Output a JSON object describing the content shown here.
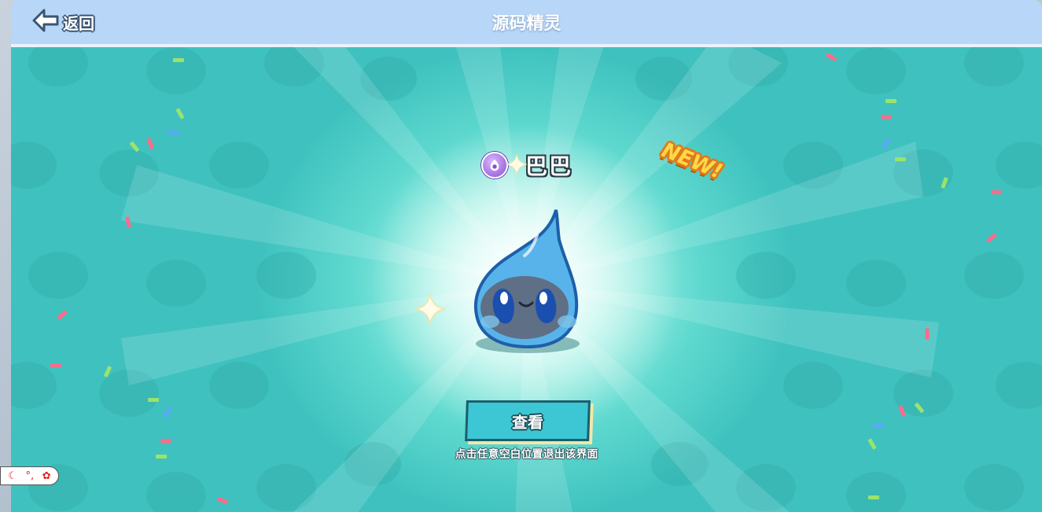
{
  "header": {
    "back_label": "返回",
    "title": "源码精灵"
  },
  "reveal": {
    "pet_name": "巴巴",
    "new_badge": "NEW!",
    "view_button_label": "查看",
    "hint": "点击任意空白位置退出该界面"
  },
  "icons": {
    "back": "arrow-left-icon",
    "rarity": "rarity-badge-icon",
    "sparkle": "sparkle-icon",
    "creature": "water-drop-creature",
    "float_tools": [
      "moon-icon",
      "dots-icon",
      "gear-icon"
    ]
  },
  "float_tool_glyphs": [
    "☾",
    "°,",
    "✿"
  ],
  "colors": {
    "topbar": "#b8d6f7",
    "stage": "#3fc2bf",
    "button": "#3dc6d3",
    "new_badge": "#ffd84a"
  }
}
